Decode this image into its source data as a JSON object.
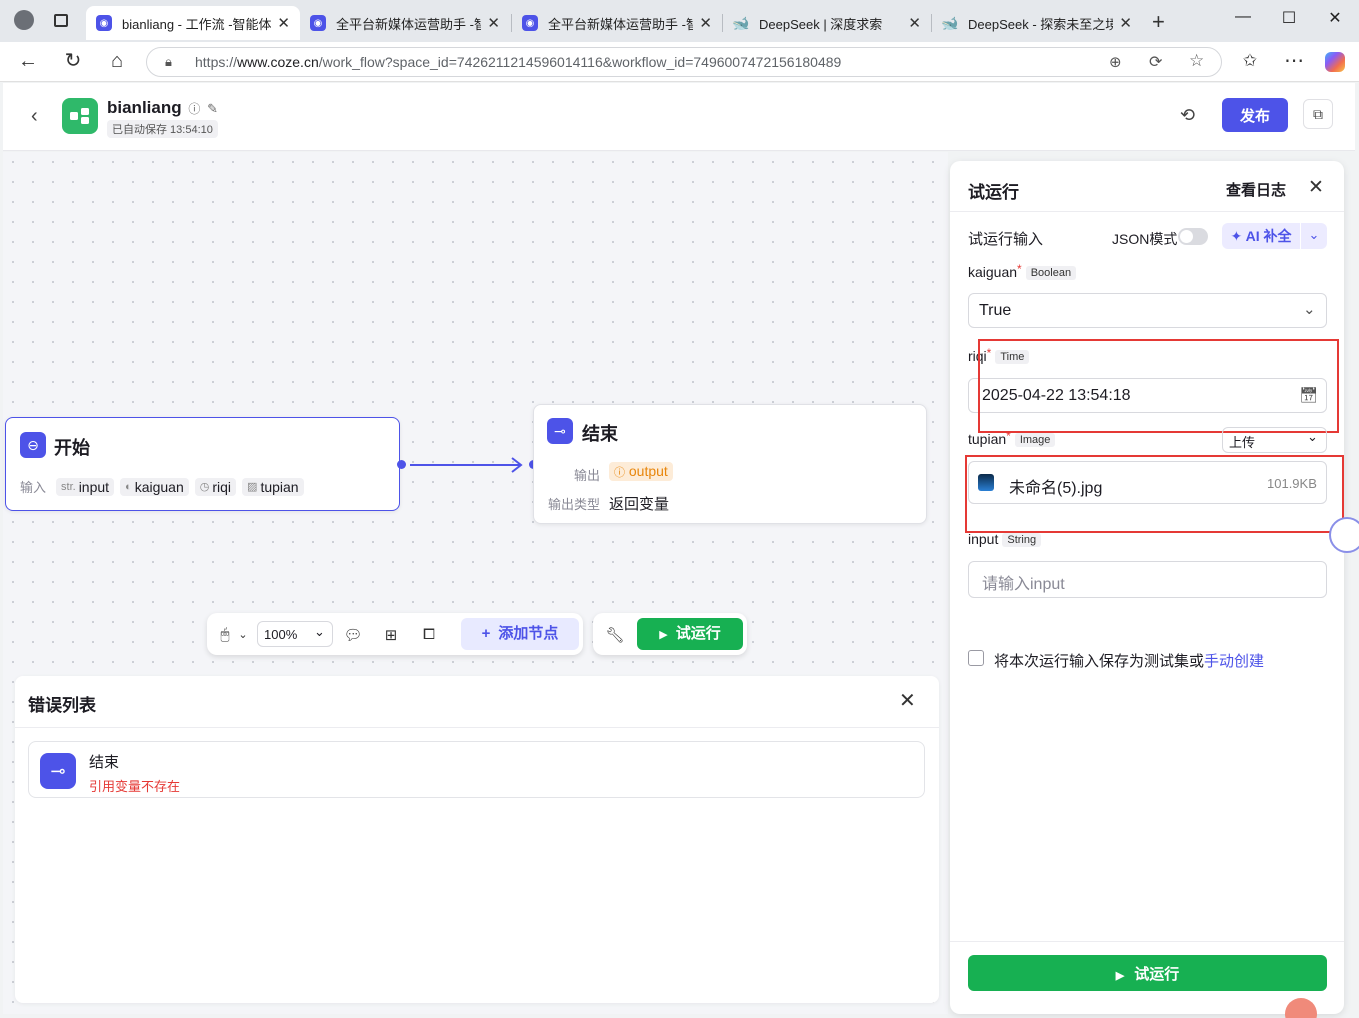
{
  "browser": {
    "tabs": [
      {
        "label": "bianliang - 工作流 -智能体平",
        "active": true
      },
      {
        "label": "全平台新媒体运营助手 -智能",
        "active": false
      },
      {
        "label": "全平台新媒体运营助手 -智能",
        "active": false
      },
      {
        "label": "DeepSeek | 深度求索",
        "active": false
      },
      {
        "label": "DeepSeek - 探索未至之境",
        "active": false
      }
    ],
    "url_prefix": "https://",
    "url_host": "www.coze.cn",
    "url_path": "/work_flow?space_id=7426211214596014116&workflow_id=7496007472156180489"
  },
  "header": {
    "title": "bianliang",
    "autosave": "已自动保存 13:54:10",
    "publish_label": "发布"
  },
  "canvas": {
    "start_node": {
      "title": "开始",
      "input_label": "输入",
      "params": [
        {
          "prefix": "str.",
          "name": "input"
        },
        {
          "prefix": "◐",
          "name": "kaiguan"
        },
        {
          "prefix": "◷",
          "name": "riqi"
        },
        {
          "prefix": "▨",
          "name": "tupian"
        }
      ]
    },
    "end_node": {
      "title": "结束",
      "output_label": "输出",
      "output_var": "output",
      "output_type_label": "输出类型",
      "output_type_value": "返回变量"
    },
    "toolbar": {
      "zoom": "100%",
      "add_node_label": "添加节点",
      "run_label": "试运行"
    }
  },
  "errors": {
    "title": "错误列表",
    "items": [
      {
        "node": "结束",
        "message": "引用变量不存在"
      }
    ]
  },
  "run_panel": {
    "title": "试运行",
    "view_log": "查看日志",
    "input_section": "试运行输入",
    "json_mode": "JSON模式",
    "ai_fill": "AI 补全",
    "fields": {
      "kaiguan": {
        "name": "kaiguan",
        "type": "Boolean",
        "value": "True"
      },
      "riqi": {
        "name": "riqi",
        "type": "Time",
        "value": "2025-04-22 13:54:18"
      },
      "tupian": {
        "name": "tupian",
        "type": "Image",
        "mode": "上传",
        "file_name": "未命名(5).jpg",
        "file_size": "101.9KB"
      },
      "input": {
        "name": "input",
        "type": "String",
        "placeholder": "请输入input"
      }
    },
    "save_hint": "将本次运行输入保存为测试集或",
    "save_link": "手动创建",
    "run_button": "试运行"
  }
}
